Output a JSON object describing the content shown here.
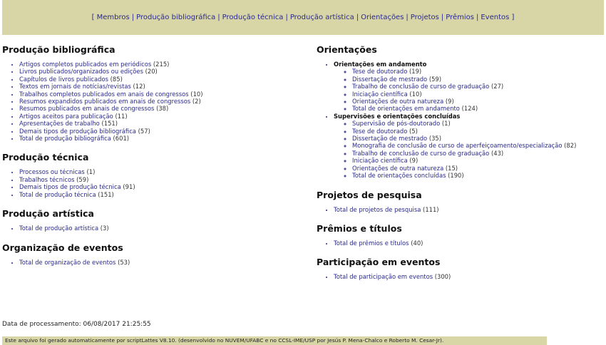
{
  "nav": {
    "open": "[",
    "close": "]",
    "items": [
      "Membros",
      "Produção bibliográfica",
      "Produção técnica",
      "Produção artística",
      "Orientações",
      "Projetos",
      "Prêmios",
      "Eventos"
    ]
  },
  "left": {
    "bib": {
      "title": "Produção bibliográfica",
      "items": [
        {
          "label": "Artigos completos publicados em periódicos",
          "count": "(215)"
        },
        {
          "label": "Livros publicados/organizados ou edições",
          "count": "(20)"
        },
        {
          "label": "Capítulos de livros publicados",
          "count": "(85)"
        },
        {
          "label": "Textos em jornais de notícias/revistas",
          "count": "(12)"
        },
        {
          "label": "Trabalhos completos publicados em anais de congressos",
          "count": "(10)"
        },
        {
          "label": "Resumos expandidos publicados em anais de congressos",
          "count": "(2)"
        },
        {
          "label": "Resumos publicados em anais de congressos",
          "count": "(38)"
        },
        {
          "label": "Artigos aceitos para publicação",
          "count": "(11)"
        },
        {
          "label": "Apresentações de trabalho",
          "count": "(151)"
        },
        {
          "label": "Demais tipos de produção bibliográfica",
          "count": "(57)"
        },
        {
          "label": "Total de produção bibliográfica",
          "count": "(601)"
        }
      ]
    },
    "tec": {
      "title": "Produção técnica",
      "items": [
        {
          "label": "Processos ou técnicas",
          "count": "(1)"
        },
        {
          "label": "Trabalhos técnicos",
          "count": "(59)"
        },
        {
          "label": "Demais tipos de produção técnica",
          "count": "(91)"
        },
        {
          "label": "Total de produção técnica",
          "count": "(151)"
        }
      ]
    },
    "art": {
      "title": "Produção artística",
      "items": [
        {
          "label": "Total de produção artística",
          "count": "(3)"
        }
      ]
    },
    "org": {
      "title": "Organização de eventos",
      "items": [
        {
          "label": "Total de organização de eventos",
          "count": "(53)"
        }
      ]
    }
  },
  "right": {
    "ori": {
      "title": "Orientações",
      "andamento": {
        "heading": "Orientações em andamento",
        "items": [
          {
            "label": "Tese de doutorado",
            "count": "(19)"
          },
          {
            "label": "Dissertação de mestrado",
            "count": "(59)"
          },
          {
            "label": "Trabalho de conclusão de curso de graduação",
            "count": "(27)"
          },
          {
            "label": "Iniciação científica",
            "count": "(10)"
          },
          {
            "label": "Orientações de outra natureza",
            "count": "(9)"
          },
          {
            "label": "Total de orientações em andamento",
            "count": "(124)"
          }
        ]
      },
      "concluidas": {
        "heading": "Supervisões e orientações concluídas",
        "items": [
          {
            "label": "Supervisão de pós-doutorado",
            "count": "(1)"
          },
          {
            "label": "Tese de doutorado",
            "count": "(5)"
          },
          {
            "label": "Dissertação de mestrado",
            "count": "(35)"
          },
          {
            "label": "Monografia de conclusão de curso de aperfeiçoamento/especialização",
            "count": "(82)"
          },
          {
            "label": "Trabalho de conclusão de curso de graduação",
            "count": "(43)"
          },
          {
            "label": "Iniciação científica",
            "count": "(9)"
          },
          {
            "label": "Orientações de outra natureza",
            "count": "(15)"
          },
          {
            "label": "Total de orientações concluídas",
            "count": "(190)"
          }
        ]
      }
    },
    "proj": {
      "title": "Projetos de pesquisa",
      "items": [
        {
          "label": "Total de projetos de pesquisa",
          "count": "(111)"
        }
      ]
    },
    "prem": {
      "title": "Prêmios e títulos",
      "items": [
        {
          "label": "Total de prêmios e títulos",
          "count": "(40)"
        }
      ]
    },
    "part": {
      "title": "Participação em eventos",
      "items": [
        {
          "label": "Total de participação em eventos",
          "count": "(300)"
        }
      ]
    }
  },
  "processing": "Data de processamento: 06/08/2017 21:25:55",
  "footer": "Este arquivo foi gerado automaticamente por scriptLattes V8.10. (desenvolvido no NUVEM/UFABC e no CCSL-IME/USP por Jesús P. Mena-Chalco e Roberto M. Cesar-Jr)."
}
